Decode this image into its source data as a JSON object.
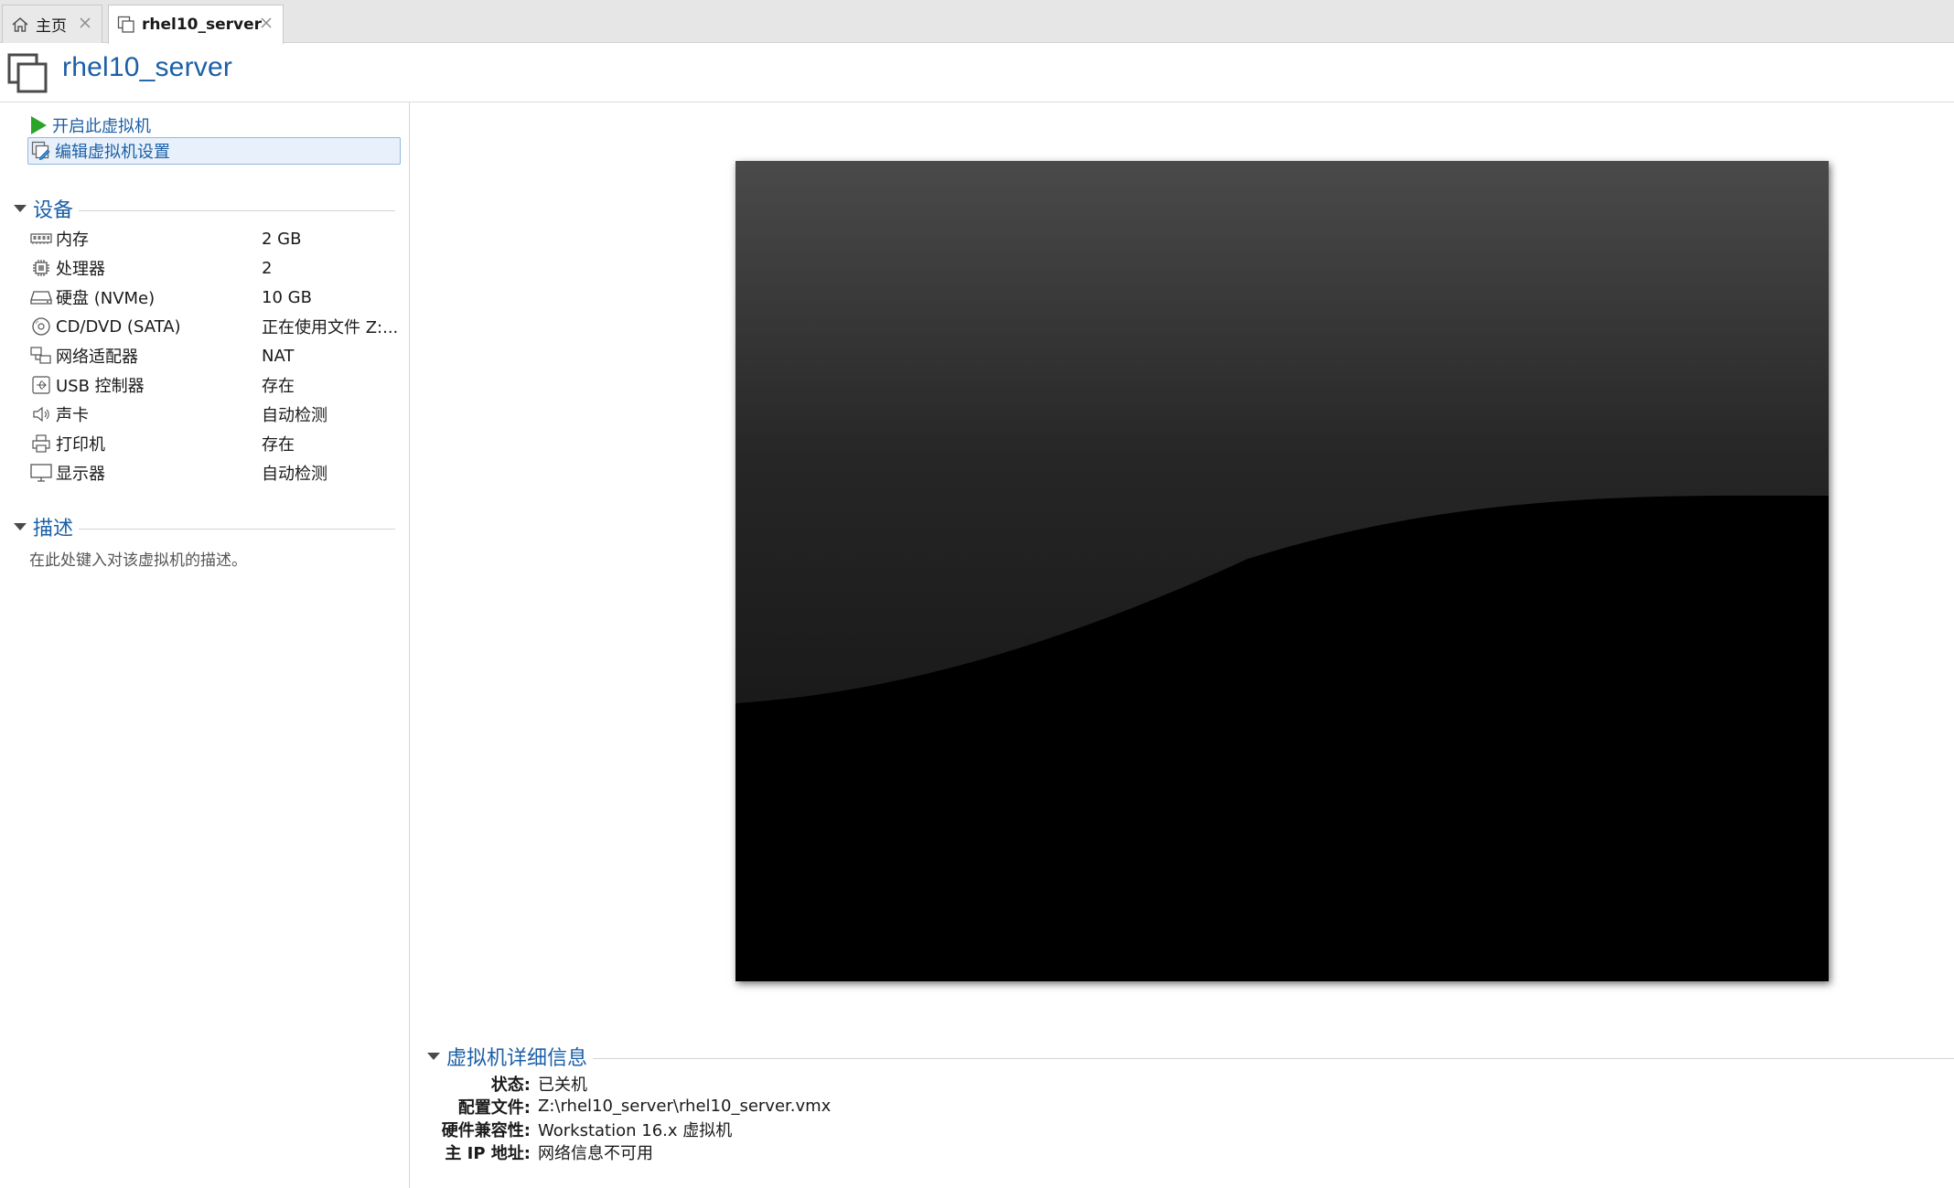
{
  "tabs": [
    {
      "label": "主页",
      "icon": "home-icon",
      "active": false
    },
    {
      "label": "rhel10_server",
      "icon": "vm-icon",
      "active": true
    }
  ],
  "vm": {
    "title": "rhel10_server"
  },
  "actions": {
    "start_label": "开启此虚拟机",
    "edit_label": "编辑虚拟机设置"
  },
  "devices_section": {
    "title": "设备",
    "items": [
      {
        "icon": "memory-icon",
        "name": "内存",
        "value": "2 GB"
      },
      {
        "icon": "processor-icon",
        "name": "处理器",
        "value": "2"
      },
      {
        "icon": "hard-disk-icon",
        "name": "硬盘 (NVMe)",
        "value": "10 GB"
      },
      {
        "icon": "cd-dvd-icon",
        "name": "CD/DVD (SATA)",
        "value": "正在使用文件 Z:..."
      },
      {
        "icon": "network-adapter-icon",
        "name": "网络适配器",
        "value": "NAT"
      },
      {
        "icon": "usb-controller-icon",
        "name": "USB 控制器",
        "value": "存在"
      },
      {
        "icon": "sound-card-icon",
        "name": "声卡",
        "value": "自动检测"
      },
      {
        "icon": "printer-icon",
        "name": "打印机",
        "value": "存在"
      },
      {
        "icon": "display-icon",
        "name": "显示器",
        "value": "自动检测"
      }
    ]
  },
  "description_section": {
    "title": "描述",
    "placeholder": "在此处键入对该虚拟机的描述。"
  },
  "details_section": {
    "title": "虚拟机详细信息",
    "rows": [
      {
        "label": "状态:",
        "value": "已关机"
      },
      {
        "label": "配置文件:",
        "value": "Z:\\rhel10_server\\rhel10_server.vmx"
      },
      {
        "label": "硬件兼容性:",
        "value": "Workstation 16.x 虚拟机"
      },
      {
        "label": "主 IP 地址:",
        "value": "网络信息不可用"
      }
    ]
  },
  "colors": {
    "accent": "#1b5fa6",
    "start_green": "#2aa52a",
    "preview_bg": "#000000"
  }
}
